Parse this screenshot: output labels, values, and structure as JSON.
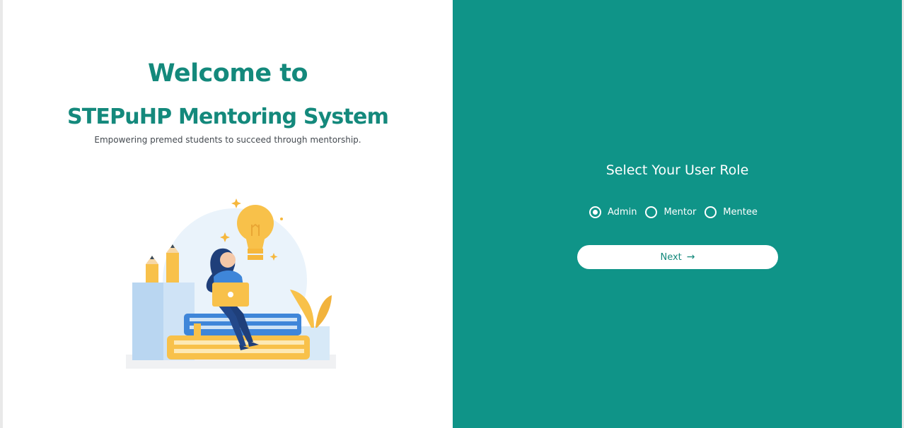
{
  "welcome": {
    "title": "Welcome to",
    "system_name": "STEPuHP Mentoring System",
    "tagline": "Empowering premed students to succeed through mentorship."
  },
  "role_selection": {
    "title": "Select Your User Role",
    "options": [
      {
        "label": "Admin",
        "selected": true
      },
      {
        "label": "Mentor",
        "selected": false
      },
      {
        "label": "Mentee",
        "selected": false
      }
    ],
    "next_label": "Next",
    "next_icon": "arrow-right-icon"
  },
  "colors": {
    "accent": "#0f9488",
    "title_text": "#14897c",
    "background": "#ffffff"
  }
}
